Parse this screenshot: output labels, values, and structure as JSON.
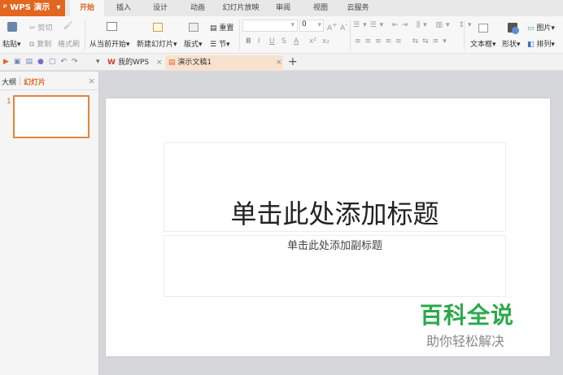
{
  "app": {
    "name": "WPS 演示"
  },
  "menu_tabs": [
    "开始",
    "插入",
    "设计",
    "动画",
    "幻灯片放映",
    "审阅",
    "视图",
    "云服务"
  ],
  "active_tab": "开始",
  "ribbon": {
    "paste": "粘贴",
    "cut": "剪切",
    "copy": "复制",
    "format_painter": "格式刷",
    "from_current": "从当前开始",
    "new_slide": "新建幻灯片",
    "layout": "版式",
    "reset": "重置",
    "section": "节",
    "font_size": "0",
    "bold": "B",
    "italic": "I",
    "underline": "U",
    "strike": "S",
    "font_color": "A",
    "superscript": "x²",
    "subscript": "x₂",
    "textbox": "文本框",
    "shape": "形状",
    "picture": "图片",
    "arrange": "排列"
  },
  "doc_tabs": [
    {
      "label": "我的WPS"
    },
    {
      "label": "演示文稿1"
    }
  ],
  "left_panel": {
    "tab_outline": "大纲",
    "tab_slides": "幻灯片",
    "slide_number": "1"
  },
  "slide": {
    "title_placeholder": "单击此处添加标题",
    "subtitle_placeholder": "单击此处添加副标题"
  },
  "watermark": {
    "line1": "百科全说",
    "line2": "助你轻松解决"
  },
  "colors": {
    "accent": "#e2661f",
    "watermark": "#2aa84a"
  }
}
